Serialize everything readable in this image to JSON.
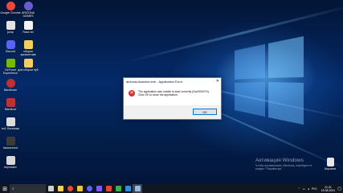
{
  "desktop": {
    "icons": [
      {
        "name": "google-chrome",
        "label": "Google Chrome",
        "color": "#e8493c"
      },
      {
        "name": "arizona-games",
        "label": "ARIZONA GAMES",
        "color": "#6a5acd"
      },
      {
        "name": "jump",
        "label": "jump",
        "color": "#e2e2e2"
      },
      {
        "name": "new-txt",
        "label": "Rase.txt",
        "color": "#f3f3f3"
      },
      {
        "name": "discord",
        "label": "Discord",
        "color": "#5865f2"
      },
      {
        "name": "folder-1",
        "label": "сборка аризонтова",
        "color": "#f4cf5a"
      },
      {
        "name": "geforce",
        "label": "GeForce Experience",
        "color": "#76b900"
      },
      {
        "name": "folder-2",
        "label": "для сборки нуб",
        "color": "#f4cf5a"
      },
      {
        "name": "bandicam",
        "label": "Bandicam",
        "color": "#c03030"
      },
      {
        "name": "bandicut",
        "label": "Bandicut",
        "color": "#c03030"
      },
      {
        "name": "ea-hardware",
        "label": "ел1 ботаники",
        "color": "#dddddd"
      },
      {
        "name": "fastconnect",
        "label": "fastconnect",
        "color": "#3b3b3b"
      },
      {
        "name": "keymaker",
        "label": "keymaker",
        "color": "#d8d8d8"
      }
    ],
    "recycle_bin_label": "Корзина"
  },
  "dialog": {
    "title": "arizona-launcher.exe - Application Error",
    "close_glyph": "✕",
    "error_glyph": "✕",
    "message_line1": "The application was unable to start correctly (0xc000007b).",
    "message_line2": "Click OK to close the application.",
    "ok_label": "OK"
  },
  "watermark": {
    "heading": "Активация Windows",
    "line1": "Чтобы активировать Windows, перейдите в",
    "line2": "раздел \"Параметры\"."
  },
  "taskbar": {
    "start_glyph": "⊞",
    "search_placeholder": "",
    "apps": [
      {
        "name": "task-view",
        "color": "#cfcfcf"
      },
      {
        "name": "explorer",
        "color": "#f4cf5a"
      },
      {
        "name": "chrome",
        "color": "#e8493c"
      },
      {
        "name": "folder",
        "color": "#f0c040"
      },
      {
        "name": "discord",
        "color": "#5865f2"
      },
      {
        "name": "arizona",
        "color": "#7a5cff"
      },
      {
        "name": "app-red",
        "color": "#d84a3a"
      },
      {
        "name": "app-green",
        "color": "#3db04a"
      },
      {
        "name": "app-blue",
        "color": "#2f8fdc"
      },
      {
        "name": "launcher-active",
        "color": "#9bb8d9"
      }
    ],
    "tray": {
      "language": "РУС",
      "time": "21:21",
      "date": "15.08.2021"
    }
  }
}
